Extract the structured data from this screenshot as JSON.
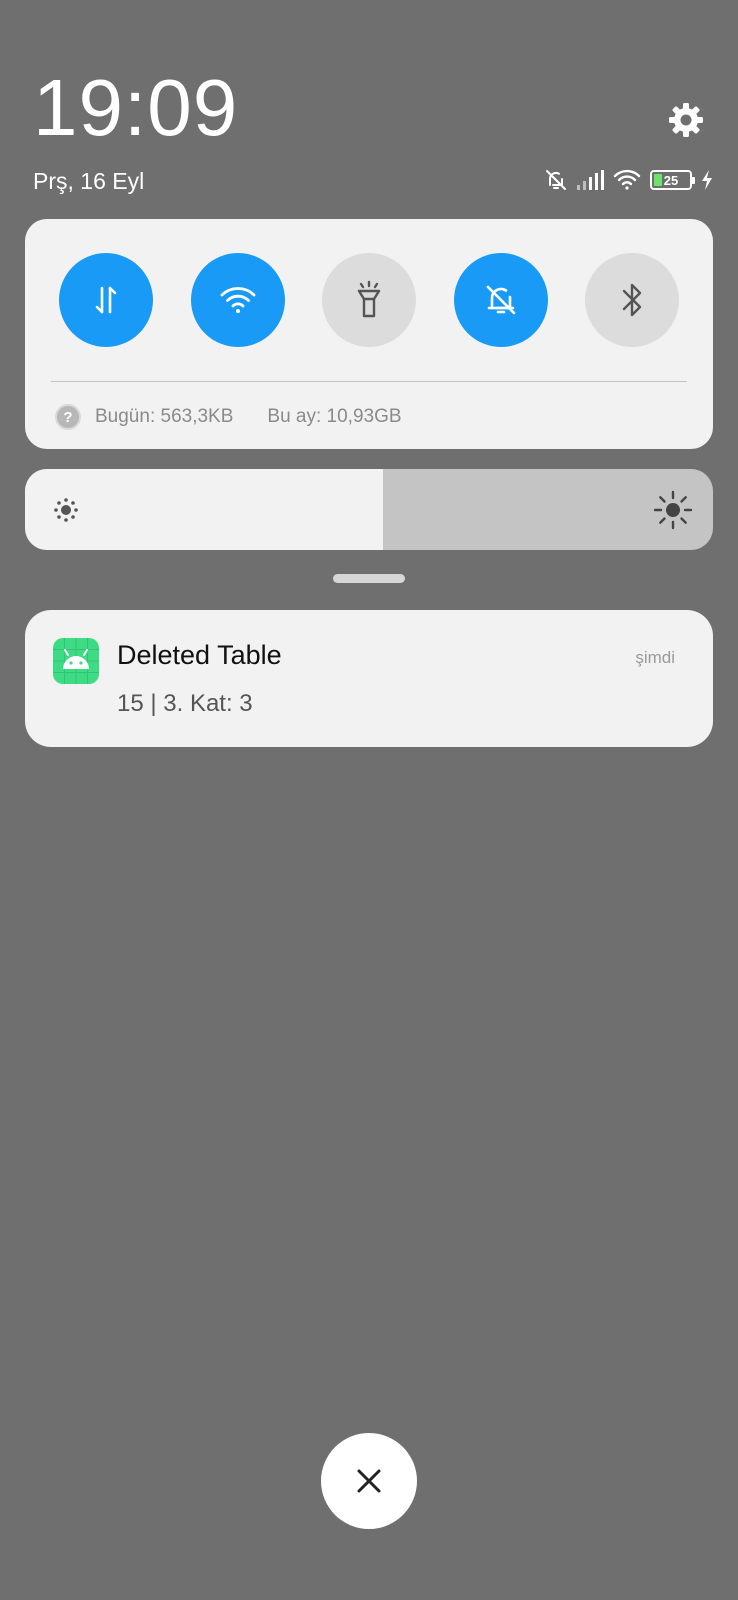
{
  "header": {
    "time": "19:09",
    "date": "Prş, 16 Eyl",
    "settings_icon": "gear-icon"
  },
  "status_bar": {
    "icons": [
      "bell-off-icon",
      "signal-icon",
      "wifi-icon",
      "battery-icon",
      "charging-icon"
    ],
    "battery_level": "25"
  },
  "quick_settings": {
    "toggles": [
      {
        "name": "mobile-data",
        "icon": "data-arrows-icon",
        "active": true
      },
      {
        "name": "wifi",
        "icon": "wifi-icon",
        "active": true
      },
      {
        "name": "flashlight",
        "icon": "flashlight-icon",
        "active": false
      },
      {
        "name": "silent",
        "icon": "bell-off-icon",
        "active": true
      },
      {
        "name": "bluetooth",
        "icon": "bluetooth-icon",
        "active": false
      }
    ],
    "usage_today": "Bugün: 563,3KB",
    "usage_month": "Bu ay: 10,93GB"
  },
  "brightness": {
    "level": 0.52
  },
  "notification": {
    "app_icon": "android-icon",
    "title": "Deleted Table",
    "time": "şimdi",
    "body": "15 | 3. Kat: 3"
  },
  "close_button_icon": "close-icon",
  "colors": {
    "background": "#6f6f6f",
    "accent": "#1a9af7",
    "panel": "#f2f2f2",
    "app_icon": "#3ddc84"
  }
}
